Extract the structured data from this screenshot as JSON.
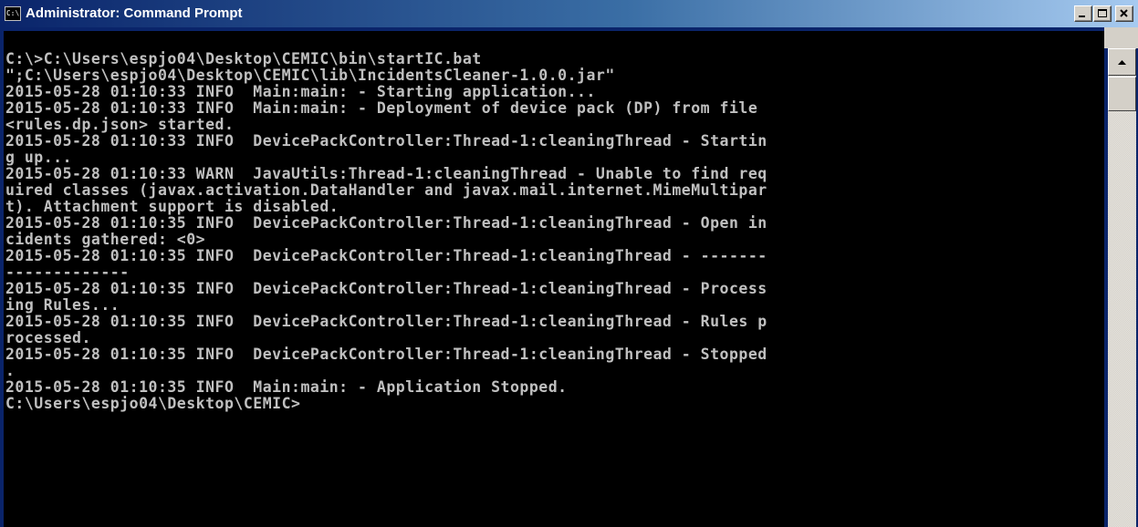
{
  "window": {
    "title": "Administrator: Command Prompt",
    "icon_text": "C:\\",
    "icon": "command-prompt-icon"
  },
  "titlebar_buttons": {
    "minimize": "minimize-icon",
    "maximize": "maximize-icon",
    "close": "close-icon"
  },
  "colors": {
    "title_active": "#0a246a",
    "console_bg": "#000000",
    "console_text": "#c0c0c0",
    "chrome": "#d4d0c8"
  },
  "console": {
    "lines": [
      "",
      "C:\\>C:\\Users\\espjo04\\Desktop\\CEMIC\\bin\\startIC.bat",
      "\";C:\\Users\\espjo04\\Desktop\\CEMIC\\lib\\IncidentsCleaner-1.0.0.jar\"",
      "2015-05-28 01:10:33 INFO  Main:main: - Starting application...",
      "2015-05-28 01:10:33 INFO  Main:main: - Deployment of device pack (DP) from file",
      "<rules.dp.json> started.",
      "2015-05-28 01:10:33 INFO  DevicePackController:Thread-1:cleaningThread - Startin",
      "g up...",
      "2015-05-28 01:10:33 WARN  JavaUtils:Thread-1:cleaningThread - Unable to find req",
      "uired classes (javax.activation.DataHandler and javax.mail.internet.MimeMultipar",
      "t). Attachment support is disabled.",
      "2015-05-28 01:10:35 INFO  DevicePackController:Thread-1:cleaningThread - Open in",
      "cidents gathered: <0>",
      "2015-05-28 01:10:35 INFO  DevicePackController:Thread-1:cleaningThread - -------",
      "-------------",
      "2015-05-28 01:10:35 INFO  DevicePackController:Thread-1:cleaningThread - Process",
      "ing Rules...",
      "2015-05-28 01:10:35 INFO  DevicePackController:Thread-1:cleaningThread - Rules p",
      "rocessed.",
      "2015-05-28 01:10:35 INFO  DevicePackController:Thread-1:cleaningThread - Stopped",
      ".",
      "2015-05-28 01:10:35 INFO  Main:main: - Application Stopped.",
      "C:\\Users\\espjo04\\Desktop\\CEMIC>"
    ]
  },
  "scrollbar": {
    "up_arrow": "arrow-up-icon"
  }
}
